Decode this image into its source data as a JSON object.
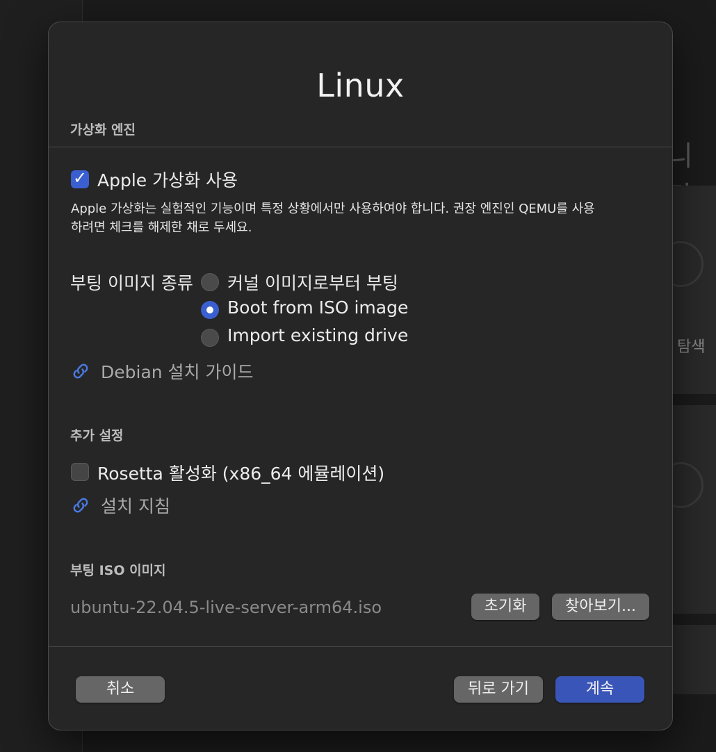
{
  "background": {
    "heading_partial": "니다.",
    "card_text": "탐색"
  },
  "dialog": {
    "title": "Linux",
    "virtualization": {
      "section_label": "가상화 엔진",
      "apple_virt_label": "Apple 가상화 사용",
      "apple_virt_checked": true,
      "description_line1": "Apple 가상화는 실험적인 기능이며 특정 상황에서만 사용하여야 합니다. 권장 엔진인 QEMU를 사용",
      "description_line2": "하려면 체크를 해제한 채로 두세요."
    },
    "boot_type": {
      "label": "부팅 이미지 종류",
      "options": [
        {
          "label": "커널 이미지로부터 부팅",
          "selected": false
        },
        {
          "label": "Boot from ISO image",
          "selected": true
        },
        {
          "label": "Import existing drive",
          "selected": false
        }
      ]
    },
    "guide_link": "Debian 설치 가이드",
    "additional": {
      "section_label": "추가 설정",
      "rosetta_label": "Rosetta 활성화 (x86_64 에뮬레이션)",
      "rosetta_checked": false,
      "install_link": "설치 지침"
    },
    "boot_iso": {
      "section_label": "부팅 ISO 이미지",
      "path": "ubuntu-22.04.5-live-server-arm64.iso",
      "clear_button": "초기화",
      "browse_button": "찾아보기..."
    },
    "footer": {
      "cancel_button": "취소",
      "back_button": "뒤로 가기",
      "continue_button": "계속"
    }
  },
  "colors": {
    "accent": "#3a5fd0",
    "primary_button": "#3a55b8",
    "secondary_button": "#666666",
    "link_icon": "#4a78e0"
  },
  "icons": {
    "link": "link-icon"
  }
}
